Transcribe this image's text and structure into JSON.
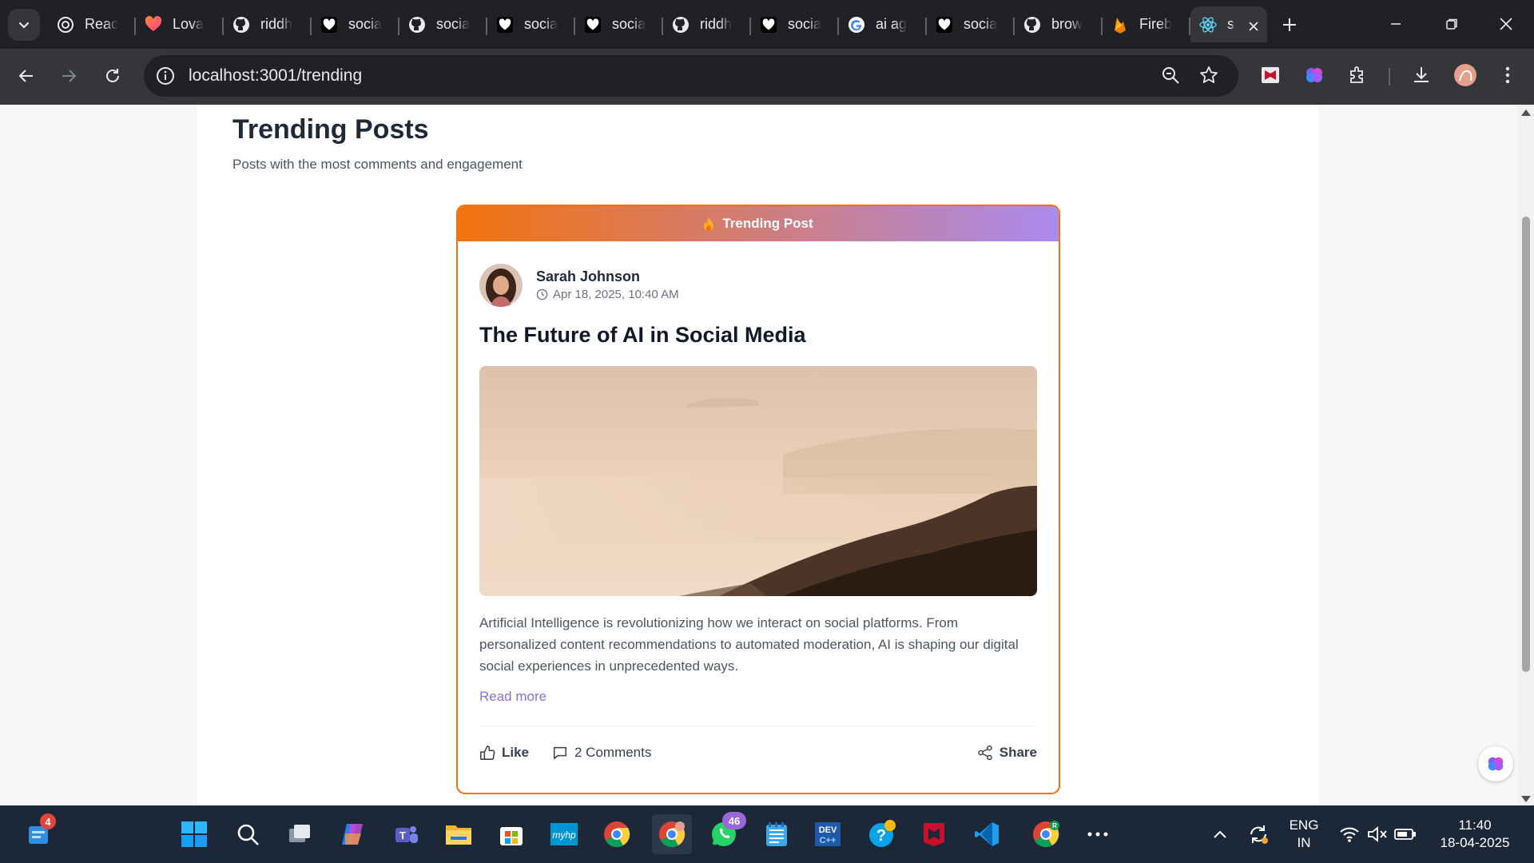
{
  "browser": {
    "tabs": [
      {
        "title": "Reac",
        "icon": "chatgpt-icon"
      },
      {
        "title": "Lova",
        "icon": "lovable-heart-icon"
      },
      {
        "title": "riddh",
        "icon": "github-icon"
      },
      {
        "title": "socia",
        "icon": "heart-icon"
      },
      {
        "title": "socia",
        "icon": "github-icon"
      },
      {
        "title": "socia",
        "icon": "heart-icon"
      },
      {
        "title": "socia",
        "icon": "heart-icon"
      },
      {
        "title": "riddh",
        "icon": "github-icon"
      },
      {
        "title": "socia",
        "icon": "heart-icon"
      },
      {
        "title": "ai ag",
        "icon": "google-icon"
      },
      {
        "title": "socia",
        "icon": "heart-icon"
      },
      {
        "title": "brow",
        "icon": "github-icon"
      },
      {
        "title": "Fireb",
        "icon": "firebase-icon"
      },
      {
        "title": "s",
        "icon": "react-icon",
        "active": true
      }
    ],
    "url": "localhost:3001/trending"
  },
  "page": {
    "title": "Trending Posts",
    "subtitle": "Posts with the most comments and engagement"
  },
  "post": {
    "banner": "Trending Post",
    "author": "Sarah Johnson",
    "timestamp": "Apr 18, 2025, 10:40 AM",
    "title": "The Future of AI in Social Media",
    "body": "Artificial Intelligence is revolutionizing how we interact on social platforms. From personalized content recommendations to automated moderation, AI is shaping our digital social experiences in unprecedented ways.",
    "read_more": "Read more",
    "like_label": "Like",
    "comments_label": "2 Comments",
    "share_label": "Share"
  },
  "colors": {
    "accent_orange": "#f2730e",
    "accent_purple": "#8b6fe0"
  },
  "taskbar": {
    "widgets_badge": "4",
    "whatsapp_badge": "46",
    "language_line1": "ENG",
    "language_line2": "IN",
    "time": "11:40",
    "date": "18-04-2025"
  }
}
